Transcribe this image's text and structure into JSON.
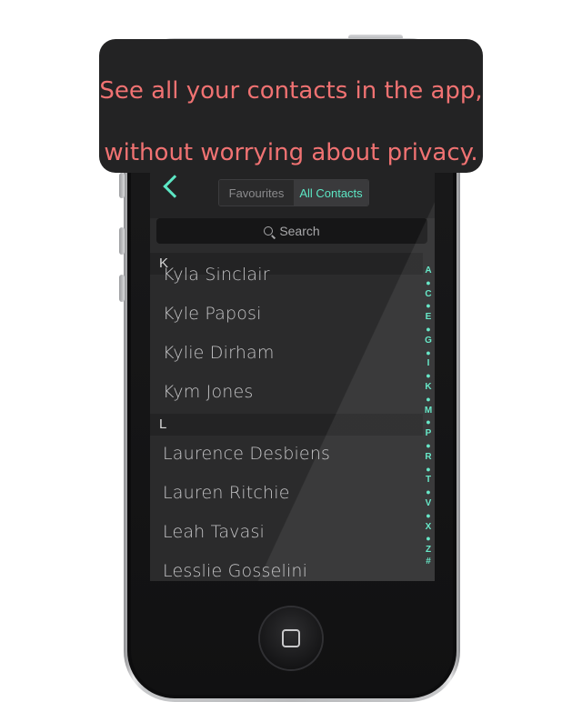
{
  "tooltip": {
    "line1": "See all your contacts in the app,",
    "line2": "without worrying about privacy."
  },
  "nav": {
    "back_icon": "chevron-left-icon",
    "tabs": [
      {
        "label": "Favourites",
        "active": false
      },
      {
        "label": "All Contacts",
        "active": true
      }
    ]
  },
  "search": {
    "label": "Search",
    "icon": "search-icon"
  },
  "sections": [
    {
      "letter": "K",
      "contacts": [
        "Kyla Sinclair",
        "Kyle Paposi",
        "Kylie Dirham",
        "Kym Jones"
      ]
    },
    {
      "letter": "L",
      "contacts": [
        "Laurence Desbiens",
        "Lauren Ritchie",
        "Leah Tavasi",
        "Lesslie Gosselini"
      ]
    }
  ],
  "index": [
    "A",
    "●",
    "C",
    "●",
    "E",
    "●",
    "G",
    "●",
    "I",
    "●",
    "K",
    "●",
    "M",
    "●",
    "P",
    "●",
    "R",
    "●",
    "T",
    "●",
    "V",
    "●",
    "X",
    "●",
    "Z",
    "#"
  ],
  "colors": {
    "accent": "#5ce6c4",
    "tooltip_text": "#f07272",
    "screen_bg": "#2b2b2c"
  }
}
